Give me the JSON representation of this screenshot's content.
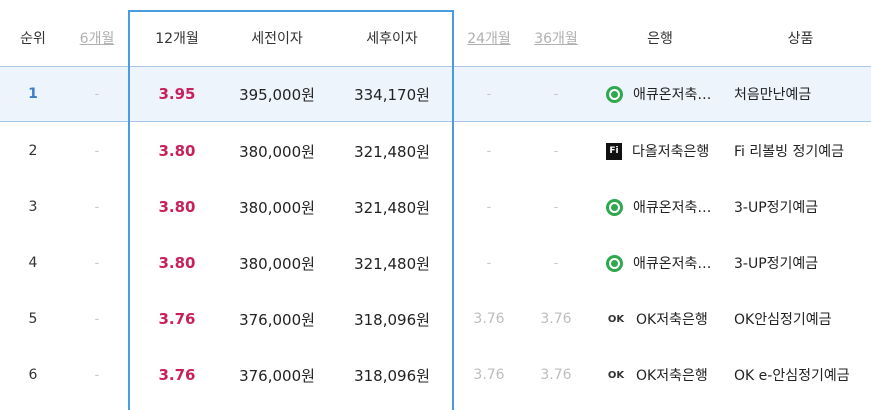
{
  "headers": {
    "rank": "순위",
    "m6": "6개월",
    "m12": "12개월",
    "pre_tax": "세전이자",
    "post_tax": "세후이자",
    "m24": "24개월",
    "m36": "36개월",
    "bank": "은행",
    "product": "상품"
  },
  "colors": {
    "rate": "#c8215a",
    "selected_rank": "#3a7fc4",
    "highlight_border": "#4b9be0",
    "selected_bg": "#eef4fb"
  },
  "rows": [
    {
      "rank": "1",
      "m6": "-",
      "m12": "3.95",
      "pre_tax": "395,000원",
      "post_tax": "334,170원",
      "m24": "-",
      "m36": "-",
      "bank_logo": "acuon-logo",
      "bank": "애큐온저축…",
      "product": "처음만난예금"
    },
    {
      "rank": "2",
      "m6": "-",
      "m12": "3.80",
      "pre_tax": "380,000원",
      "post_tax": "321,480원",
      "m24": "-",
      "m36": "-",
      "bank_logo": "daol-logo",
      "bank": "다올저축은행",
      "product": "Fi 리볼빙 정기예금"
    },
    {
      "rank": "3",
      "m6": "-",
      "m12": "3.80",
      "pre_tax": "380,000원",
      "post_tax": "321,480원",
      "m24": "-",
      "m36": "-",
      "bank_logo": "acuon-logo",
      "bank": "애큐온저축…",
      "product": "3-UP정기예금"
    },
    {
      "rank": "4",
      "m6": "-",
      "m12": "3.80",
      "pre_tax": "380,000원",
      "post_tax": "321,480원",
      "m24": "-",
      "m36": "-",
      "bank_logo": "acuon-logo",
      "bank": "애큐온저축…",
      "product": "3-UP정기예금"
    },
    {
      "rank": "5",
      "m6": "-",
      "m12": "3.76",
      "pre_tax": "376,000원",
      "post_tax": "318,096원",
      "m24": "3.76",
      "m36": "3.76",
      "bank_logo": "ok-logo",
      "bank": "OK저축은행",
      "product": "OK안심정기예금"
    },
    {
      "rank": "6",
      "m6": "-",
      "m12": "3.76",
      "pre_tax": "376,000원",
      "post_tax": "318,096원",
      "m24": "3.76",
      "m36": "3.76",
      "bank_logo": "ok-logo",
      "bank": "OK저축은행",
      "product": "OK e-안심정기예금"
    }
  ],
  "logo_text": {
    "daol": "Fi",
    "ok": "OK"
  }
}
